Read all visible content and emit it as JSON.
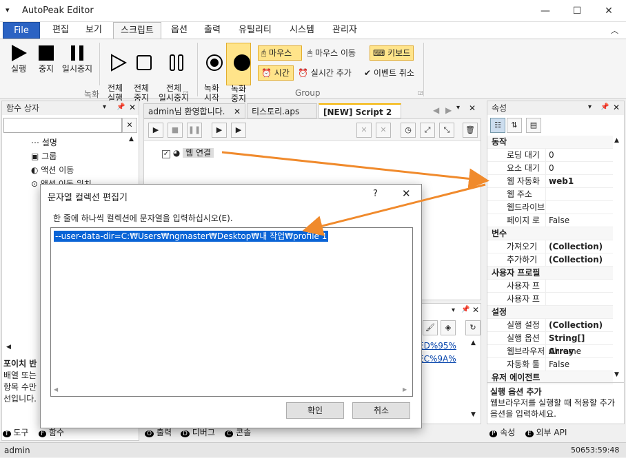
{
  "window": {
    "title": "AutoPeak Editor"
  },
  "menu": {
    "file": "File",
    "items": [
      "편집",
      "보기",
      "스크립트",
      "옵션",
      "출력",
      "유틸리티",
      "시스템",
      "관리자"
    ]
  },
  "ribbon": {
    "run": "실행",
    "stop": "중지",
    "pause": "일시중지",
    "run_all": "전체\n실행",
    "stop_all": "전체\n중지",
    "pause_all": "전체\n일시중지",
    "rec_start": "녹화\n시작",
    "rec_stop": "녹화\n중지",
    "mouse": "마우스",
    "mouse_move": "마우스 이동",
    "keyboard": "키보드",
    "time": "시간",
    "realtime_add": "실시간 추가",
    "event_cancel": "이벤트 취소",
    "group_record": "녹화",
    "group_group": "Group"
  },
  "left_panel": {
    "title": "함수 상자",
    "items": [
      "설명",
      "그룹",
      "액션 이동",
      "액션 이동 위치"
    ],
    "desc_title": "포이치 반",
    "desc_text": [
      "배열 또는",
      "항목 수만",
      "선입니다."
    ],
    "tabs": [
      "도구",
      "함수"
    ]
  },
  "doc_tabs": [
    {
      "label": "admin님 환영합니다."
    },
    {
      "label": "티스토리.aps"
    },
    {
      "label": "[NEW] Script 2"
    }
  ],
  "script": {
    "node_label": "웹 연결"
  },
  "output": {
    "links": [
      "ED%95%",
      "EC%9A%"
    ],
    "tabs": [
      "출력",
      "디버그",
      "콘솔"
    ]
  },
  "properties": {
    "title": "속성",
    "rows": [
      {
        "name": "동작",
        "value": "",
        "cat": true
      },
      {
        "name": "로딩 대기",
        "value": "0"
      },
      {
        "name": "요소 대기",
        "value": "0"
      },
      {
        "name": "웹 자동화",
        "value": "web1",
        "bold": true
      },
      {
        "name": "웹 주소",
        "value": ""
      },
      {
        "name": "웹드라이브",
        "value": ""
      },
      {
        "name": "페이지 로",
        "value": "False"
      },
      {
        "name": "변수",
        "value": "",
        "cat": true
      },
      {
        "name": "가져오기",
        "value": "(Collection)",
        "bold": true
      },
      {
        "name": "추가하기",
        "value": "(Collection)",
        "bold": true
      },
      {
        "name": "사용자 프로필",
        "value": "",
        "cat": true
      },
      {
        "name": "사용자 프",
        "value": ""
      },
      {
        "name": "사용자 프",
        "value": ""
      },
      {
        "name": "설정",
        "value": "",
        "cat": true
      },
      {
        "name": "실행 설정",
        "value": "(Collection)",
        "bold": true
      },
      {
        "name": "실행 옵션",
        "value": "String[] Array",
        "bold": true
      },
      {
        "name": "웹브라우저",
        "value": "Chrome"
      },
      {
        "name": "자동화 툴",
        "value": "False"
      },
      {
        "name": "유저 에이전트",
        "value": "",
        "cat": true
      }
    ],
    "help_title": "실행 옵션 추가",
    "help_text": "웹브라우저를 실행할 때 적용할 추가 옵션을 입력하세요.",
    "tabs": [
      "속성",
      "외부 API"
    ]
  },
  "dialog": {
    "title": "문자열 컬렉션 편집기",
    "help": "?",
    "instruction": "한 줄에 하나씩 컬렉션에 문자열을 입력하십시오(E).",
    "text": "--user-data-dir=C:₩Users₩ngmaster₩Desktop₩내 작업₩profile 1",
    "ok": "확인",
    "cancel": "취소"
  },
  "status": {
    "user": "admin",
    "time": "50653:59:48"
  },
  "colors": {
    "accent": "#2b63c3",
    "arrow": "#f08a2c",
    "highlight": "#ffe48a",
    "selection": "#0a64d6"
  }
}
